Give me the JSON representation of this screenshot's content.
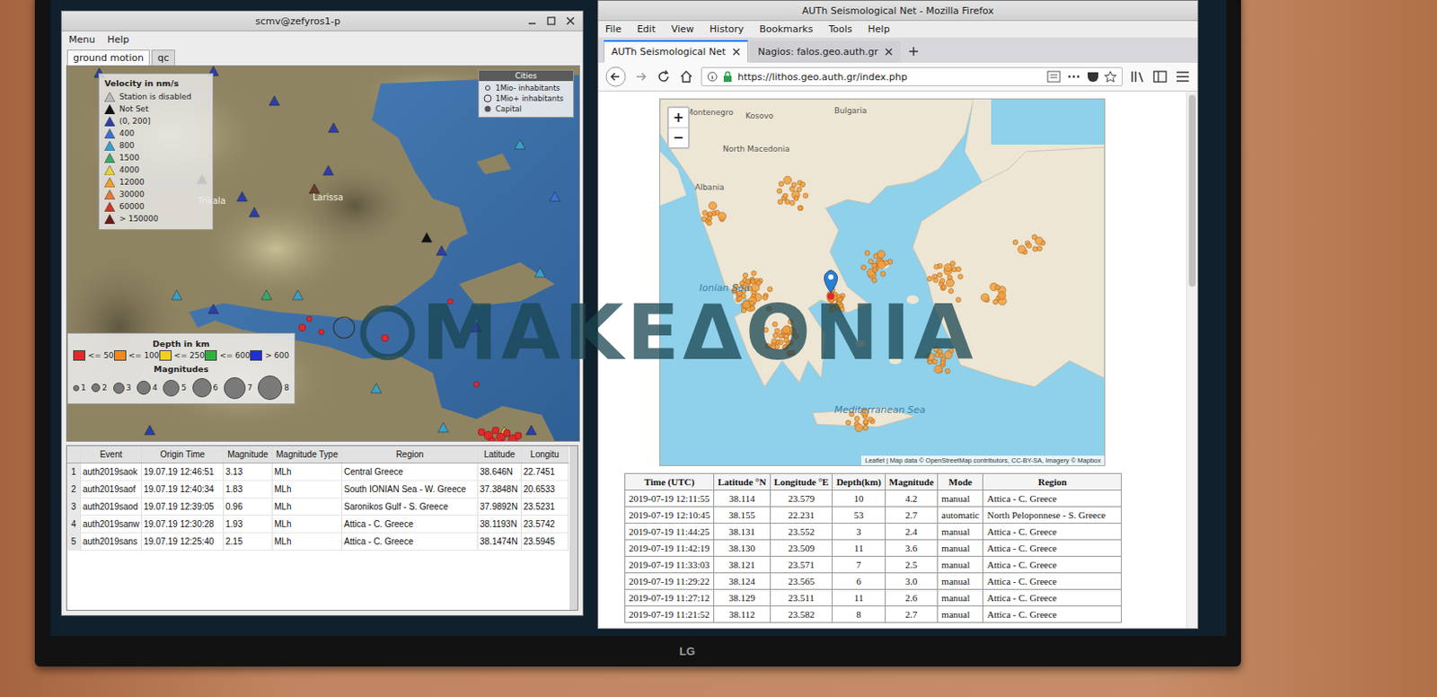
{
  "monitor": {
    "brand": "LG"
  },
  "watermark": {
    "text": "ΜΑΚΕΔΟΝΙΑ"
  },
  "scmv": {
    "window": {
      "title": "scmv@zefyros1-p"
    },
    "menu": [
      "Menu",
      "Help"
    ],
    "tabs": [
      {
        "label": "ground motion",
        "selected": true
      },
      {
        "label": "qc",
        "selected": false
      }
    ],
    "velocity_legend": {
      "title": "Velocity in nm/s",
      "items": [
        {
          "label": "Station is disabled",
          "color": "#b9b9b9"
        },
        {
          "label": "Not Set",
          "color": "#111111"
        },
        {
          "label": "(0, 200]",
          "color": "#2b3fa8"
        },
        {
          "label": "400",
          "color": "#3d6fd0"
        },
        {
          "label": "800",
          "color": "#3aa0c8"
        },
        {
          "label": "1500",
          "color": "#3aa86a"
        },
        {
          "label": "4000",
          "color": "#e8d23a"
        },
        {
          "label": "12000",
          "color": "#f0a030"
        },
        {
          "label": "30000",
          "color": "#e07a40"
        },
        {
          "label": "60000",
          "color": "#c83a2a"
        },
        {
          "label": "> 150000",
          "color": "#6b1a14"
        }
      ]
    },
    "cities_legend": {
      "title": "Cities",
      "items": [
        {
          "label": "1Mio- inhabitants",
          "kind": "small"
        },
        {
          "label": "1Mio+ inhabitants",
          "kind": "large"
        },
        {
          "label": "Capital",
          "kind": "capital"
        }
      ]
    },
    "depth_legend": {
      "title": "Depth in km",
      "items": [
        {
          "label": "<= 50",
          "color": "#e02a2a"
        },
        {
          "label": "<= 100",
          "color": "#f08a20"
        },
        {
          "label": "<= 250",
          "color": "#f0d020"
        },
        {
          "label": "<= 600",
          "color": "#30b040"
        },
        {
          "label": "> 600",
          "color": "#2030d0"
        }
      ]
    },
    "magnitude_legend": {
      "title": "Magnitudes",
      "items": [
        "1",
        "2",
        "3",
        "4",
        "5",
        "6",
        "7",
        "8"
      ]
    },
    "map_labels": [
      "Trikala",
      "Larissa"
    ],
    "stations": [
      {
        "color": "#2b3fa8"
      },
      {
        "color": "#2b3fa8"
      },
      {
        "color": "#2b3fa8"
      },
      {
        "color": "#2b3fa8"
      },
      {
        "color": "#2b3fa8"
      },
      {
        "color": "#3aa0c8"
      },
      {
        "color": "#111111"
      },
      {
        "color": "#2b3fa8"
      },
      {
        "color": "#6b3a2a"
      },
      {
        "color": "#2b3fa8"
      },
      {
        "color": "#111111"
      },
      {
        "color": "#2b3fa8"
      },
      {
        "color": "#3aa0c8"
      },
      {
        "color": "#3aa0c8"
      },
      {
        "color": "#2b3fa8"
      },
      {
        "color": "#3aa86a"
      },
      {
        "color": "#3aa0c8"
      },
      {
        "color": "#3aa0c8"
      },
      {
        "color": "#e8d23a"
      },
      {
        "color": "#2b3fa8"
      },
      {
        "color": "#2b3fa8"
      },
      {
        "color": "#3aa0c8"
      },
      {
        "color": "#2b3fa8"
      },
      {
        "color": "#3d6fd0"
      },
      {
        "color": "#2b3fa8"
      }
    ],
    "table": {
      "columns": [
        "",
        "Event",
        "Origin Time",
        "Magnitude",
        "Magnitude Type",
        "Region",
        "Latitude",
        "Longitu"
      ],
      "rows": [
        {
          "cells": [
            "1",
            "auth2019saok",
            "19.07.19 12:46:51",
            "3.13",
            "MLh",
            "Central Greece",
            "38.646N",
            "22.7451"
          ]
        },
        {
          "cells": [
            "2",
            "auth2019saof",
            "19.07.19 12:40:34",
            "1.83",
            "MLh",
            "South IONIAN Sea - W. Greece",
            "37.3848N",
            "20.6533"
          ]
        },
        {
          "cells": [
            "3",
            "auth2019saod",
            "19.07.19 12:39:05",
            "0.96",
            "MLh",
            "Saronikos Gulf - S. Greece",
            "37.9892N",
            "23.5231"
          ]
        },
        {
          "cells": [
            "4",
            "auth2019sanw",
            "19.07.19 12:30:28",
            "1.93",
            "MLh",
            "Attica - C. Greece",
            "38.1193N",
            "23.5742"
          ]
        },
        {
          "cells": [
            "5",
            "auth2019sans",
            "19.07.19 12:25:40",
            "2.15",
            "MLh",
            "Attica - C. Greece",
            "38.1474N",
            "23.5945"
          ]
        }
      ]
    }
  },
  "firefox": {
    "window": {
      "title": "AUTh Seismological Net - Mozilla Firefox"
    },
    "menu": [
      "File",
      "Edit",
      "View",
      "History",
      "Bookmarks",
      "Tools",
      "Help"
    ],
    "tabs": [
      {
        "label": "AUTh Seismological Net",
        "selected": true
      },
      {
        "label": "Nagios: falos.geo.auth.gr",
        "selected": false
      }
    ],
    "url": "https://lithos.geo.auth.gr/index.php",
    "map": {
      "zoom": [
        "+",
        "−"
      ],
      "labels": [
        "Montenegro",
        "Kosovo",
        "Bulgaria",
        "North Macedonia",
        "Albania",
        "Ionian Sea",
        "Mediterranean Sea"
      ],
      "attribution": "Leaflet | Map data © OpenStreetMap contributors, CC-BY-SA, Imagery © Mapbox"
    },
    "table": {
      "columns": [
        "Time (UTC)",
        "Latitude °N",
        "Longitude °E",
        "Depth(km)",
        "Magnitude",
        "Mode",
        "Region"
      ],
      "rows": [
        {
          "cells": [
            "2019-07-19 12:11:55",
            "38.114",
            "23.579",
            "10",
            "4.2",
            "manual",
            "Attica - C. Greece"
          ]
        },
        {
          "cells": [
            "2019-07-19 12:10:45",
            "38.155",
            "22.231",
            "53",
            "2.7",
            "automatic",
            "North Peloponnese - S. Greece"
          ]
        },
        {
          "cells": [
            "2019-07-19 11:44:25",
            "38.131",
            "23.552",
            "3",
            "2.4",
            "manual",
            "Attica - C. Greece"
          ]
        },
        {
          "cells": [
            "2019-07-19 11:42:19",
            "38.130",
            "23.509",
            "11",
            "3.6",
            "manual",
            "Attica - C. Greece"
          ]
        },
        {
          "cells": [
            "2019-07-19 11:33:03",
            "38.121",
            "23.571",
            "7",
            "2.5",
            "manual",
            "Attica - C. Greece"
          ]
        },
        {
          "cells": [
            "2019-07-19 11:29:22",
            "38.124",
            "23.565",
            "6",
            "3.0",
            "manual",
            "Attica - C. Greece"
          ]
        },
        {
          "cells": [
            "2019-07-19 11:27:12",
            "38.129",
            "23.511",
            "11",
            "2.6",
            "manual",
            "Attica - C. Greece"
          ]
        },
        {
          "cells": [
            "2019-07-19 11:21:52",
            "38.112",
            "23.582",
            "8",
            "2.7",
            "manual",
            "Attica - C. Greece"
          ]
        }
      ]
    }
  }
}
